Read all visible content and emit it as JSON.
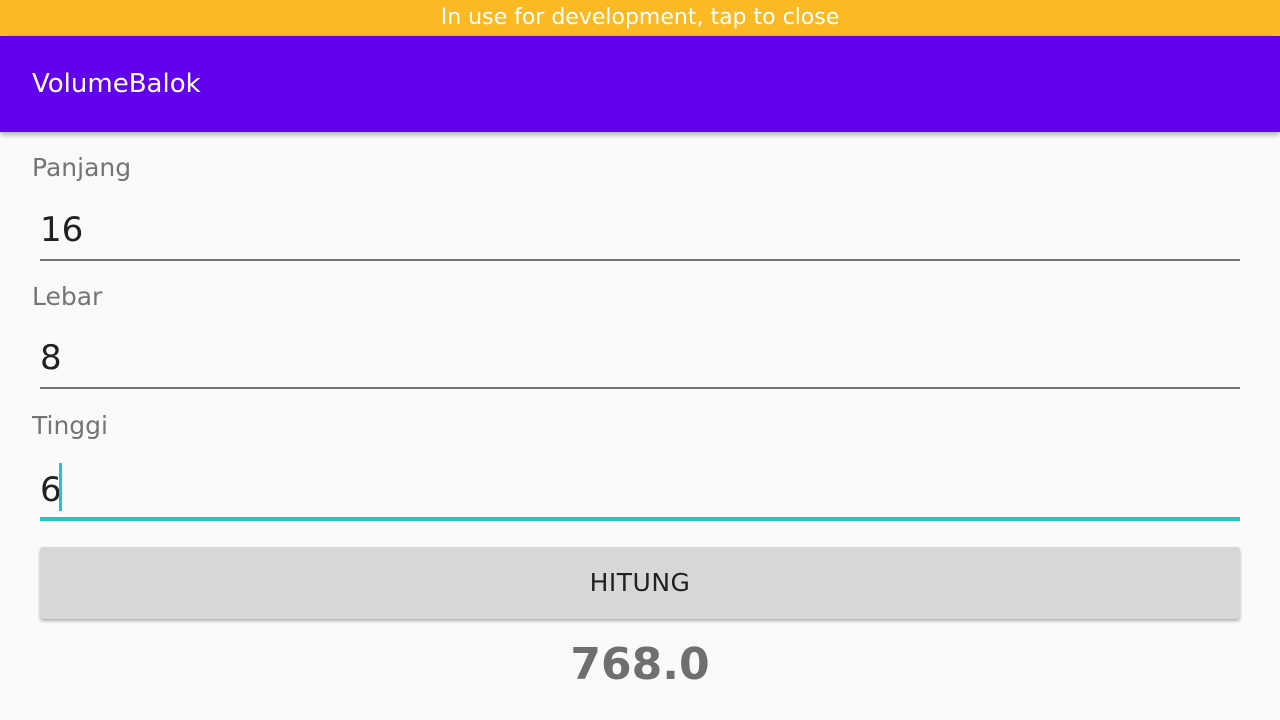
{
  "banner": {
    "text": "In use for development, tap to close"
  },
  "app_bar": {
    "title": "VolumeBalok"
  },
  "form": {
    "panjang": {
      "label": "Panjang",
      "value": "16"
    },
    "lebar": {
      "label": "Lebar",
      "value": "8"
    },
    "tinggi": {
      "label": "Tinggi",
      "value": "6"
    }
  },
  "button": {
    "label": "HITUNG"
  },
  "result": {
    "value": "768.0"
  },
  "colors": {
    "banner": "#fbb924",
    "app_bar": "#6200ee",
    "accent": "#26c6c0",
    "button": "#d6d7d7"
  }
}
